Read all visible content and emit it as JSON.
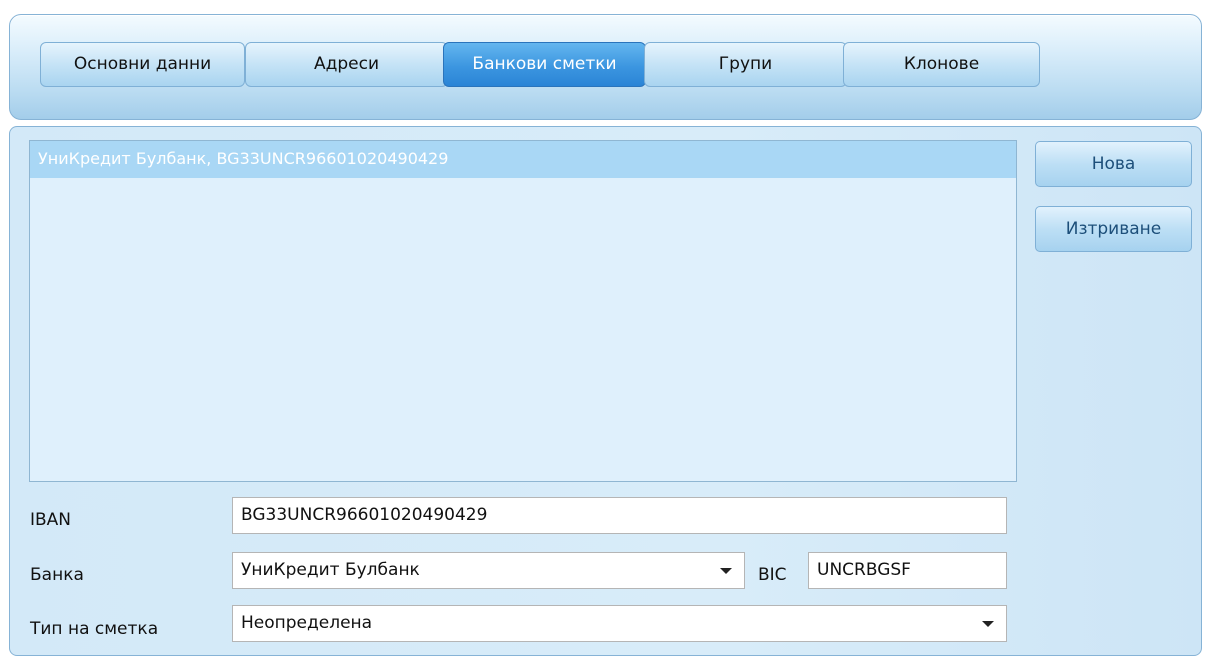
{
  "tabs": [
    {
      "label": "Основни данни",
      "active": false
    },
    {
      "label": "Адреси",
      "active": false
    },
    {
      "label": "Банкови сметки",
      "active": true
    },
    {
      "label": "Групи",
      "active": false
    },
    {
      "label": "Клонове",
      "active": false
    }
  ],
  "accounts_list": {
    "items": [
      {
        "label": "УниКредит Булбанк, BG33UNCR96601020490429",
        "selected": true
      }
    ]
  },
  "actions": {
    "new_label": "Нова",
    "delete_label": "Изтриване"
  },
  "form": {
    "iban": {
      "label": "IBAN",
      "value": "BG33UNCR96601020490429"
    },
    "bank": {
      "label": "Банка",
      "value": "УниКредит Булбанк"
    },
    "bic": {
      "label": "BIC",
      "value": "UNCRBGSF"
    },
    "account_type": {
      "label": "Тип на сметка",
      "value": "Неопределена"
    }
  },
  "colors": {
    "active_tab": "#3c96e0",
    "selected_row": "#a9d7f5",
    "panel_background": "#d3e9f8"
  },
  "icons": {
    "dropdown": "chevron-down-icon"
  }
}
